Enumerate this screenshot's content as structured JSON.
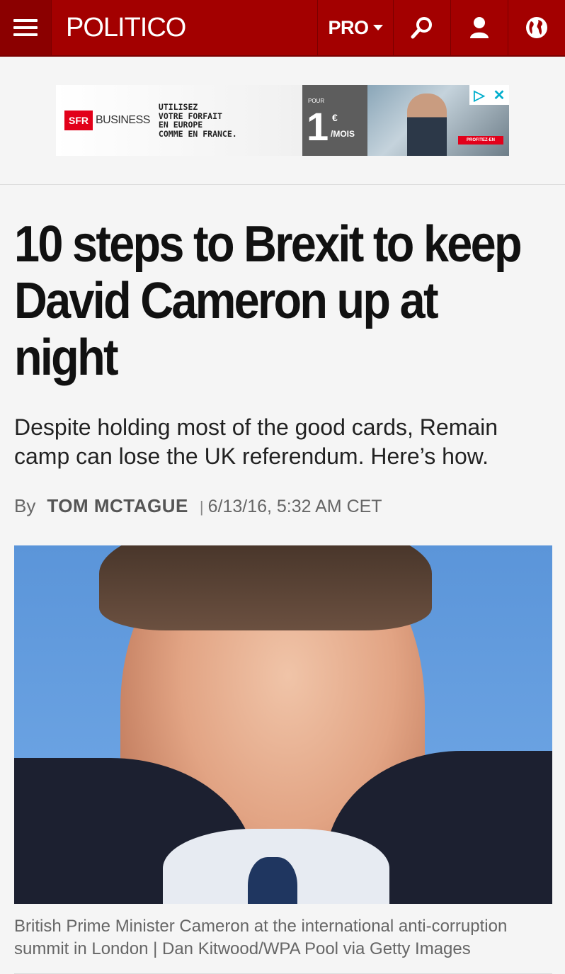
{
  "header": {
    "logo": "POLITICO",
    "pro_label": "PRO",
    "icons": {
      "menu": "hamburger-icon",
      "search": "search-icon",
      "account": "user-icon",
      "edition": "globe-icon"
    }
  },
  "ad": {
    "brand_box": "SFR",
    "brand_name": "BUSINESS",
    "line1": "UTILISEZ",
    "line2": "VOTRE FORFAIT",
    "line3": "EN EUROPE",
    "line4": "COMME EN FRANCE.",
    "pour": "POUR",
    "price": "1",
    "euro": "€",
    "per": "/MOIS",
    "cta": "PROFITEZ-EN"
  },
  "article": {
    "headline": "10 steps to Brexit to keep David Cameron up at night",
    "dek": "Despite holding most of the good cards, Remain camp can lose the UK referendum. Here’s how.",
    "byline_prefix": "By",
    "author": "TOM MCTAGUE",
    "separator": "|",
    "date": "6/13/16, 5:32 AM CET",
    "caption": "British Prime Minister Cameron at the international anti-corruption summit in London | Dan Kitwood/WPA Pool via Getty Images"
  },
  "colors": {
    "brand": "#a30000",
    "brand_dark": "#8b0000"
  }
}
